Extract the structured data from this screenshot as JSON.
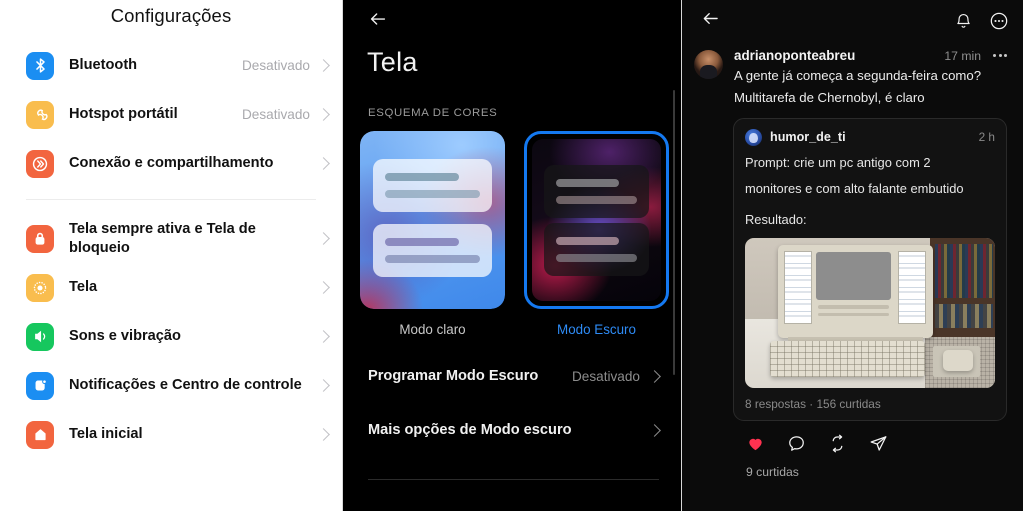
{
  "panels": {
    "settings": {
      "title": "Configurações",
      "groups": [
        {
          "items": [
            {
              "label": "Bluetooth",
              "value": "Desativado",
              "icon": "bluetooth-icon",
              "color": "#1b8ef2"
            },
            {
              "label": "Hotspot portátil",
              "value": "Desativado",
              "icon": "hotspot-icon",
              "color": "#f9bd4e"
            },
            {
              "label": "Conexão e compartilhamento",
              "value": "",
              "icon": "connection-share-icon",
              "color": "#f2653f"
            }
          ]
        },
        {
          "items": [
            {
              "label": "Tela sempre ativa e Tela de bloqueio",
              "value": "",
              "icon": "lock-icon",
              "color": "#f2653f"
            },
            {
              "label": "Tela",
              "value": "",
              "icon": "brightness-icon",
              "color": "#f9bd4e"
            },
            {
              "label": "Sons e vibração",
              "value": "",
              "icon": "speaker-icon",
              "color": "#16c75e"
            },
            {
              "label": "Notificações e Centro de controle",
              "value": "",
              "icon": "notifications-icon",
              "color": "#1b8ef2"
            },
            {
              "label": "Tela inicial",
              "value": "",
              "icon": "home-icon",
              "color": "#f2653f"
            }
          ]
        }
      ]
    },
    "display": {
      "back_icon": "arrow-left-icon",
      "title": "Tela",
      "section_label": "ESQUEMA DE CORES",
      "themes": [
        {
          "label": "Modo claro",
          "selected": false
        },
        {
          "label": "Modo Escuro",
          "selected": true
        }
      ],
      "accent_color": "#1479f0",
      "options": [
        {
          "label": "Programar Modo Escuro",
          "value": "Desativado"
        },
        {
          "label": "Mais opções de Modo escuro",
          "value": ""
        }
      ]
    },
    "feed": {
      "header": {
        "back_icon": "arrow-left-icon",
        "bell_icon": "bell-icon",
        "more_icon": "more-circle-icon"
      },
      "post": {
        "avatar": "user-avatar",
        "username": "adrianoponteabreu",
        "time": "17 min",
        "more_icon": "more-horizontal-icon",
        "text_line_1": "A gente já começa a segunda-feira como?",
        "text_line_2": "Multitarefa de Chernobyl, é claro",
        "quote": {
          "avatar": "quoted-user-avatar",
          "username": "humor_de_ti",
          "time": "2 h",
          "text_line_1": "Prompt: crie um pc antigo com 2",
          "text_line_2": "monitores e com alto falante embutido",
          "text_line_3": "Resultado:",
          "image_alt": "retro-desktop-computer-photo",
          "stats": "8 respostas · 156 curtidas"
        },
        "actions": [
          {
            "icon": "heart-filled-icon",
            "active": true,
            "color": "#ff3250"
          },
          {
            "icon": "comment-icon",
            "active": false
          },
          {
            "icon": "repost-icon",
            "active": false
          },
          {
            "icon": "share-icon",
            "active": false
          }
        ],
        "likes": "9 curtidas"
      }
    }
  }
}
